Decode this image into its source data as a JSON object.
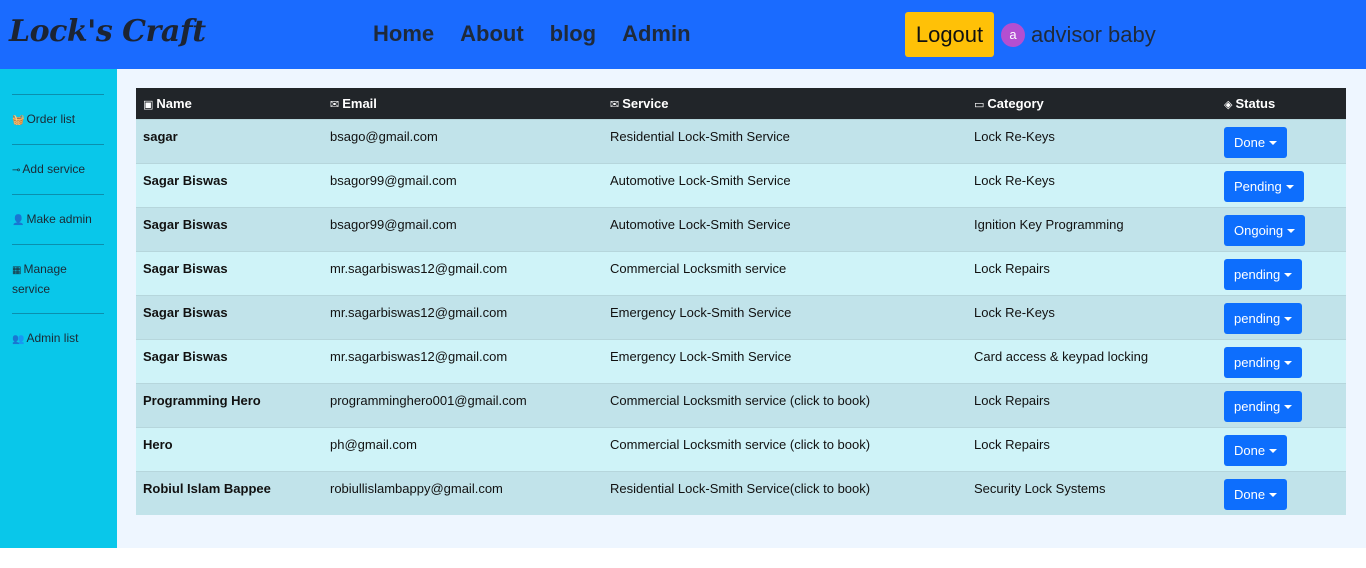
{
  "header": {
    "logo": "Lock's Craft",
    "nav": [
      "Home",
      "About",
      "blog",
      "Admin"
    ],
    "logout_label": "Logout",
    "avatar_initial": "a",
    "username": "advisor baby"
  },
  "sidebar": {
    "items": [
      {
        "icon": "basket-icon",
        "glyph": "🧺",
        "label": "Order list"
      },
      {
        "icon": "add-service-icon",
        "glyph": "⊸",
        "label": "Add service"
      },
      {
        "icon": "user-plus-icon",
        "glyph": "👤",
        "label": "Make admin"
      },
      {
        "icon": "manage-icon",
        "glyph": "▦",
        "label": "Manage service"
      },
      {
        "icon": "users-icon",
        "glyph": "👥",
        "label": "Admin list"
      }
    ]
  },
  "table": {
    "headers": [
      {
        "icon": "name-icon",
        "glyph": "▣",
        "label": "Name"
      },
      {
        "icon": "email-icon",
        "glyph": "✉",
        "label": "Email"
      },
      {
        "icon": "service-icon",
        "glyph": "✉",
        "label": "Service"
      },
      {
        "icon": "category-icon",
        "glyph": "▭",
        "label": "Category"
      },
      {
        "icon": "status-icon",
        "glyph": "◈",
        "label": "Status"
      }
    ],
    "rows": [
      {
        "name": "sagar",
        "email": "bsago@gmail.com",
        "service": "Residential Lock-Smith Service",
        "category": "Lock Re-Keys",
        "status": "Done"
      },
      {
        "name": "Sagar Biswas",
        "email": "bsagor99@gmail.com",
        "service": "Automotive Lock-Smith Service",
        "category": "Lock Re-Keys",
        "status": "Pending"
      },
      {
        "name": "Sagar Biswas",
        "email": "bsagor99@gmail.com",
        "service": "Automotive Lock-Smith Service",
        "category": "Ignition Key Programming",
        "status": "Ongoing"
      },
      {
        "name": "Sagar Biswas",
        "email": "mr.sagarbiswas12@gmail.com",
        "service": "Commercial Locksmith service",
        "category": "Lock Repairs",
        "status": "pending"
      },
      {
        "name": "Sagar Biswas",
        "email": "mr.sagarbiswas12@gmail.com",
        "service": "Emergency Lock-Smith Service",
        "category": "Lock Re-Keys",
        "status": "pending"
      },
      {
        "name": "Sagar Biswas",
        "email": "mr.sagarbiswas12@gmail.com",
        "service": "Emergency Lock-Smith Service",
        "category": "Card access & keypad locking",
        "status": "pending"
      },
      {
        "name": "Programming Hero",
        "email": "programminghero001@gmail.com",
        "service": "Commercial Locksmith service (click to book)",
        "category": "Lock Repairs",
        "status": "pending"
      },
      {
        "name": "Hero",
        "email": "ph@gmail.com",
        "service": "Commercial Locksmith service (click to book)",
        "category": "Lock Repairs",
        "status": "Done"
      },
      {
        "name": "Robiul Islam Bappee",
        "email": "robiullislambappy@gmail.com",
        "service": "Residential Lock-Smith Service(click to book)",
        "category": "Security Lock Systems",
        "status": "Done"
      }
    ]
  },
  "colors": {
    "header_bg": "#1a6bff",
    "sidebar_bg": "#09c7ea",
    "logout_bg": "#ffc107",
    "status_btn_bg": "#0d6efd",
    "row_odd": "#c1e3ea",
    "row_even": "#cff3f8",
    "table_head_bg": "#212529",
    "avatar_bg": "#b34fd1"
  }
}
